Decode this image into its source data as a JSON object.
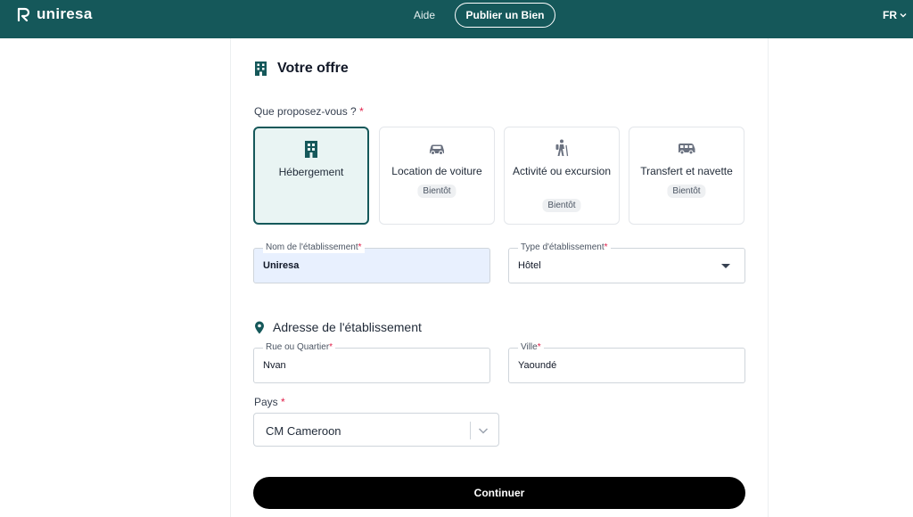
{
  "header": {
    "logo_text": "uniresa",
    "help_link": "Aide",
    "publish_button": "Publier un Bien",
    "language": "FR"
  },
  "offer": {
    "title": "Votre offre",
    "question": "Que proposez-vous ?",
    "required_mark": "*",
    "options": [
      {
        "label": "Hébergement",
        "badge": "",
        "selected": true,
        "icon": "building-icon"
      },
      {
        "label": "Location de voiture",
        "badge": "Bientôt",
        "selected": false,
        "icon": "car-icon"
      },
      {
        "label": "Activité ou excursion",
        "badge": "Bientôt",
        "selected": false,
        "icon": "hiker-icon"
      },
      {
        "label": "Transfert et navette",
        "badge": "Bientôt",
        "selected": false,
        "icon": "shuttle-icon"
      }
    ]
  },
  "establishment": {
    "name_label": "Nom de l'établissement",
    "name_value": "Uniresa",
    "type_label": "Type d'établissement",
    "type_value": "Hôtel"
  },
  "address": {
    "title": "Adresse de l'établissement",
    "street_label": "Rue ou Quartier",
    "street_value": "Nvan",
    "city_label": "Ville",
    "city_value": "Yaoundé",
    "country_label": "Pays",
    "country_value": "CM Cameroon"
  },
  "actions": {
    "continue": "Continuer"
  },
  "colors": {
    "header_bg": "#15585a",
    "accent": "#15585a",
    "selected_card_bg": "#e9f4f3",
    "required": "#e11d48",
    "button_bg": "#000000"
  }
}
